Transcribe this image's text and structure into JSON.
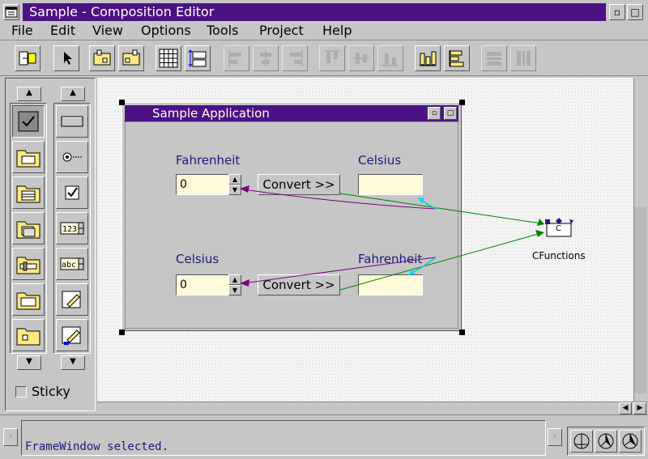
{
  "window": {
    "title": "Sample - Composition Editor"
  },
  "menu": [
    "File",
    "Edit",
    "View",
    "Options",
    "Tools",
    "Project",
    "Help"
  ],
  "palette": {
    "sticky_label": "Sticky"
  },
  "frame": {
    "title": "Sample Application"
  },
  "form": {
    "row1": {
      "input_label": "Fahrenheit",
      "input_value": "0",
      "button": "Convert >>",
      "output_label": "Celsius"
    },
    "row2": {
      "input_label": "Celsius",
      "input_value": "0",
      "button": "Convert >>",
      "output_label": "Fahrenheit"
    }
  },
  "part": {
    "name": "CFunctions",
    "glyph": "C"
  },
  "status": {
    "message": "FrameWindow selected."
  },
  "colors": {
    "titlebar": "#4b1283",
    "entry_bg": "#fffbd8",
    "connection_green": "#008000",
    "connection_purple": "#800080",
    "connection_cyan": "#00c8e0"
  }
}
